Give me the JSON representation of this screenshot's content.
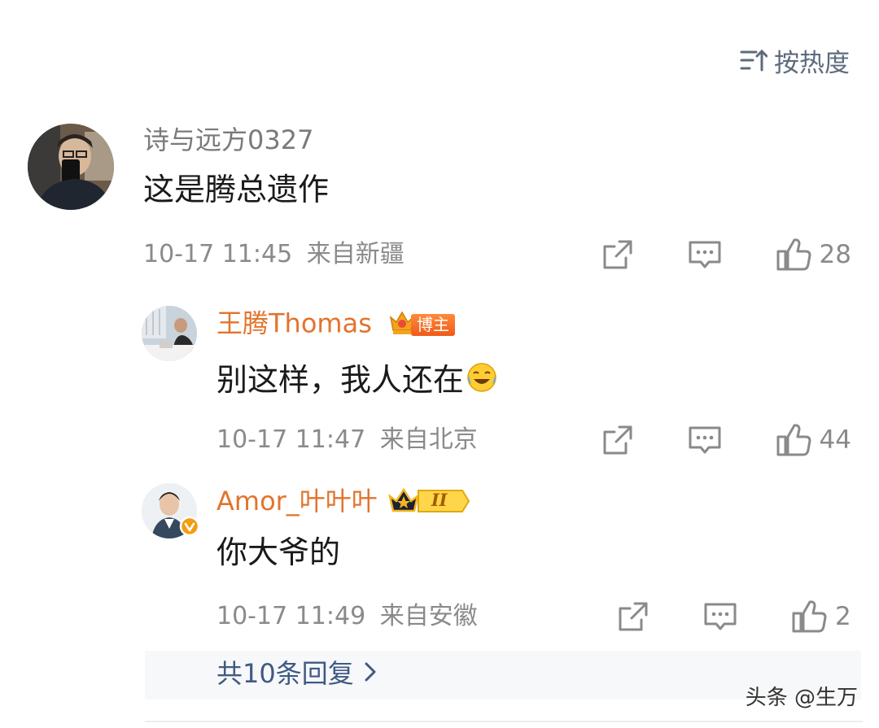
{
  "sort": {
    "label": "按热度",
    "icon": "sort-icon"
  },
  "comments": [
    {
      "user": "诗与远方0327",
      "text": "这是腾总遗作",
      "time": "10-17 11:45",
      "location": "来自新疆",
      "likes": "28",
      "name_color": "#8a8a8a"
    },
    {
      "user": "王腾Thomas",
      "badge": "博主",
      "text": "别这样，我人还在",
      "time": "10-17 11:47",
      "location": "来自北京",
      "likes": "44",
      "name_color": "#e2742c"
    },
    {
      "user": "Amor_叶叶叶",
      "badge_level": "II",
      "text": "你大爷的",
      "time": "10-17 11:49",
      "location": "来自安徽",
      "likes": "2",
      "name_color": "#e2742c"
    }
  ],
  "more_replies": "共10条回复",
  "watermark": "头条 @生万",
  "colors": {
    "accent_orange": "#e2742c",
    "link_blue": "#3f5a82",
    "meta_gray": "#8a8a8a"
  }
}
